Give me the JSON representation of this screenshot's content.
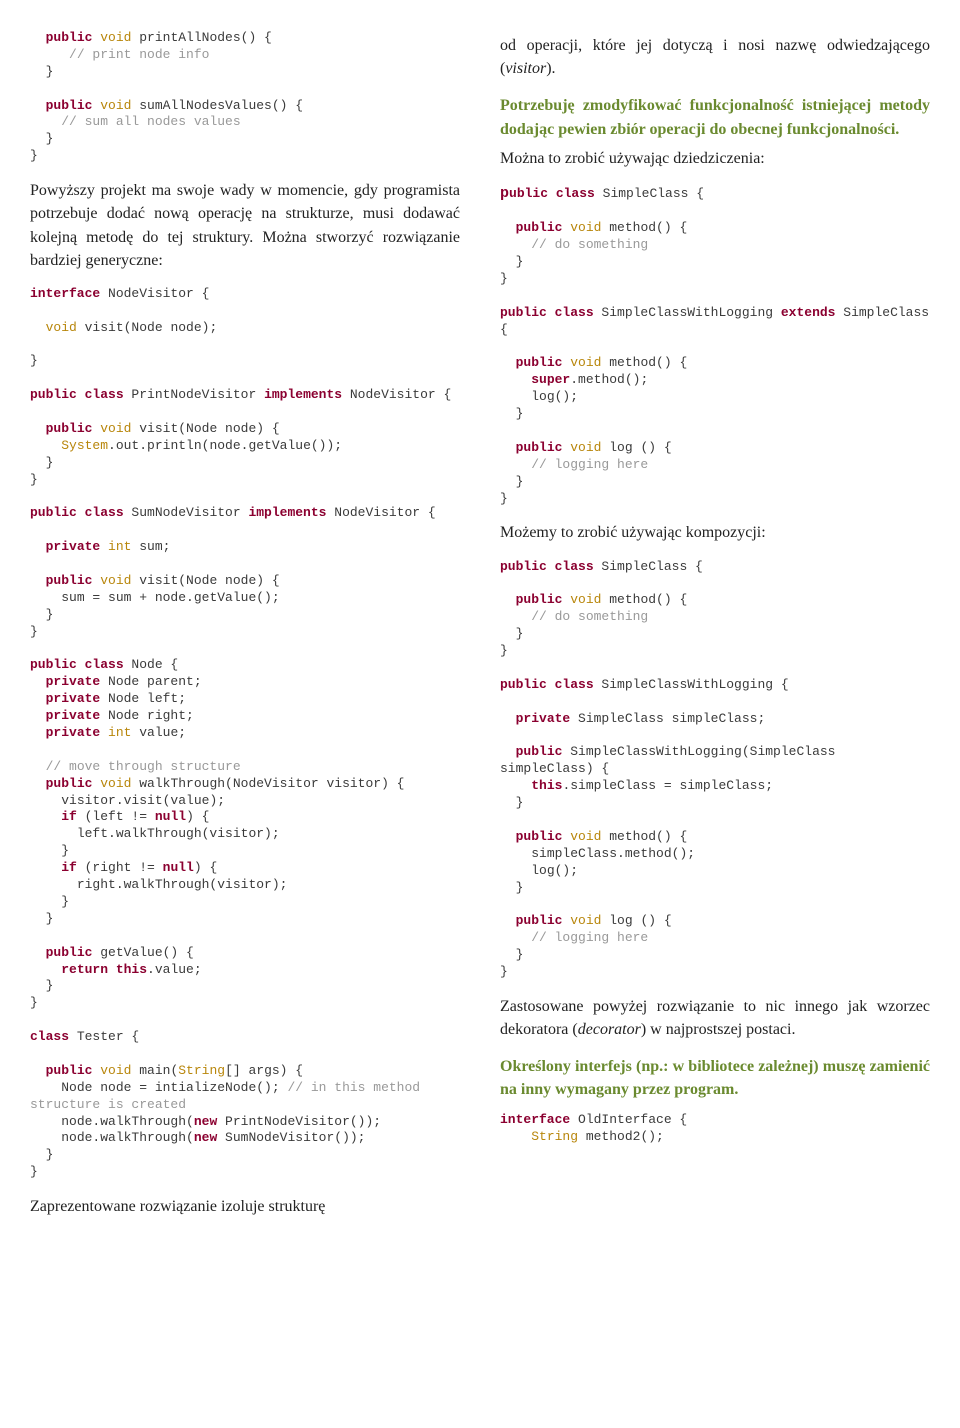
{
  "left": {
    "code1": {
      "l1a": "  public",
      "l1b": " void",
      "l1c": " printAllNodes() {",
      "l2": "     // print node info",
      "l3": "  }",
      "l4": "",
      "l5a": "  public",
      "l5b": " void",
      "l5c": " sumAllNodesValues() {",
      "l6": "    // sum all nodes values",
      "l7": "  }",
      "l8": "}"
    },
    "para1": "Powyższy projekt ma swoje wady w momencie, gdy programista  potrzebuje dodać nową operację na strukturze, musi dodawać kolejną metodę do tej struktury. Można stworzyć rozwiązanie bardziej generyczne:",
    "code2": {
      "l1a": "interface",
      "l1b": " NodeVisitor {",
      "l2": "",
      "l3a": "  void",
      "l3b": " visit(Node node);",
      "l4": "",
      "l5": "}",
      "l6": "",
      "l7a": "public",
      "l7b": " class",
      "l7c": " PrintNodeVisitor ",
      "l7d": "implements",
      "l7e": " NodeVisitor {",
      "l8": "",
      "l9a": "  public",
      "l9b": " void",
      "l9c": " visit(Node node) {",
      "l10a": "    System",
      "l10b": ".out.println(node.getValue());",
      "l11": "  }",
      "l12": "}",
      "l13": "",
      "l14a": "public",
      "l14b": " class",
      "l14c": " SumNodeVisitor ",
      "l14d": "implements",
      "l14e": " NodeVisitor {",
      "l15": "",
      "l16a": "  private",
      "l16b": " int",
      "l16c": " sum;",
      "l17": "",
      "l18a": "  public",
      "l18b": " void",
      "l18c": " visit(Node node) {",
      "l19": "    sum = sum + node.getValue();",
      "l20": "  }",
      "l21": "}",
      "l22": "",
      "l23a": "public",
      "l23b": " class",
      "l23c": " Node {",
      "l24a": "  private",
      "l24b": " Node parent;",
      "l25a": "  private",
      "l25b": " Node left;",
      "l26a": "  private",
      "l26b": " Node right;",
      "l27a": "  private",
      "l27b": " int",
      "l27c": " value;",
      "l28": "",
      "l29": "  // move through structure",
      "l30a": "  public",
      "l30b": " void",
      "l30c": " walkThrough(NodeVisitor visitor) {",
      "l31": "    visitor.visit(value);",
      "l32a": "    if",
      "l32b": " (left != ",
      "l32c": "null",
      "l32d": ") {",
      "l33": "      left.walkThrough(visitor);",
      "l34": "    }",
      "l35a": "    if",
      "l35b": " (right != ",
      "l35c": "null",
      "l35d": ") {",
      "l36": "      right.walkThrough(visitor);",
      "l37": "    }",
      "l38": "  }",
      "l39": "",
      "l40a": "  public",
      "l40b": " getValue() {",
      "l41a": "    return",
      "l41b": " this",
      "l41c": ".value;",
      "l42": "  }",
      "l43": "}",
      "l44": "",
      "l45a": "class",
      "l45b": " Tester {",
      "l46": "",
      "l47a": "  public",
      "l47b": " void",
      "l47c": " main(",
      "l47d": "String",
      "l47e": "[] args) {",
      "l48a": "    Node node = intializeNode(); ",
      "l48b": "// in this method structure is created",
      "l49a": "    node.walkThrough(",
      "l49b": "new",
      "l49c": " PrintNodeVisitor());",
      "l50a": "    node.walkThrough(",
      "l50b": "new",
      "l50c": " SumNodeVisitor());",
      "l51": "  }",
      "l52": "}"
    },
    "para2": "Zaprezentowane rozwiązanie izoluje strukturę"
  },
  "right": {
    "para1a": "od operacji, które jej dotyczą i nosi nazwę odwiedzającego (",
    "para1b": "visitor",
    "para1c": ").",
    "heading1": "Potrzebuję zmodyfikować funkcjonalność istniejącej metody dodając pewien zbiór operacji do obecnej funkcjonalności.",
    "para2": "Można to zrobić używając dziedziczenia:",
    "code1": {
      "l1a": "public",
      "l1b": " class",
      "l1c": " SimpleClass {",
      "l2": "",
      "l3a": "  public",
      "l3b": " void",
      "l3c": " method() {",
      "l4": "    // do something",
      "l5": "  }",
      "l6": "}",
      "l7": "",
      "l8a": "public",
      "l8b": " class",
      "l8c": " SimpleClassWithLogging ",
      "l8d": "extends",
      "l8e": " SimpleClass {",
      "l9": "",
      "l10a": "  public",
      "l10b": " void",
      "l10c": " method() {",
      "l11a": "    super",
      "l11b": ".method();",
      "l12": "    log();",
      "l13": "  }",
      "l14": "",
      "l15a": "  public",
      "l15b": " void",
      "l15c": " log () {",
      "l16": "    // logging here",
      "l17": "  }",
      "l18": "}"
    },
    "para3": "Możemy to zrobić używając kompozycji:",
    "code2": {
      "l1a": "public",
      "l1b": " class",
      "l1c": " SimpleClass {",
      "l2": "",
      "l3a": "  public",
      "l3b": " void",
      "l3c": " method() {",
      "l4": "    // do something",
      "l5": "  }",
      "l6": "}",
      "l7": "",
      "l8a": "public",
      "l8b": " class",
      "l8c": " SimpleClassWithLogging {",
      "l9": "",
      "l10a": "  private",
      "l10b": " SimpleClass simpleClass;",
      "l11": "",
      "l12a": "  public",
      "l12b": " SimpleClassWithLogging(SimpleClass simpleClass) {",
      "l13a": "    this",
      "l13b": ".simpleClass = simpleClass;",
      "l14": "  }",
      "l15": "",
      "l16a": "  public",
      "l16b": " void",
      "l16c": " method() {",
      "l17": "    simpleClass.method();",
      "l18": "    log();",
      "l19": "  }",
      "l20": "",
      "l21a": "  public",
      "l21b": " void",
      "l21c": " log () {",
      "l22": "    // logging here",
      "l23": "  }",
      "l24": "}"
    },
    "para4a": "Zastosowane powyżej rozwiązanie to nic innego jak wzorzec dekoratora (",
    "para4b": "decorator",
    "para4c": ") w najprostszej postaci.",
    "heading2": "Określony interfejs (np.: w bibliotece zależnej) muszę zamienić na inny wymagany przez program.",
    "code3": {
      "l1a": "interface",
      "l1b": " OldInterface {",
      "l2a": "    String",
      "l2b": " method2();"
    }
  }
}
